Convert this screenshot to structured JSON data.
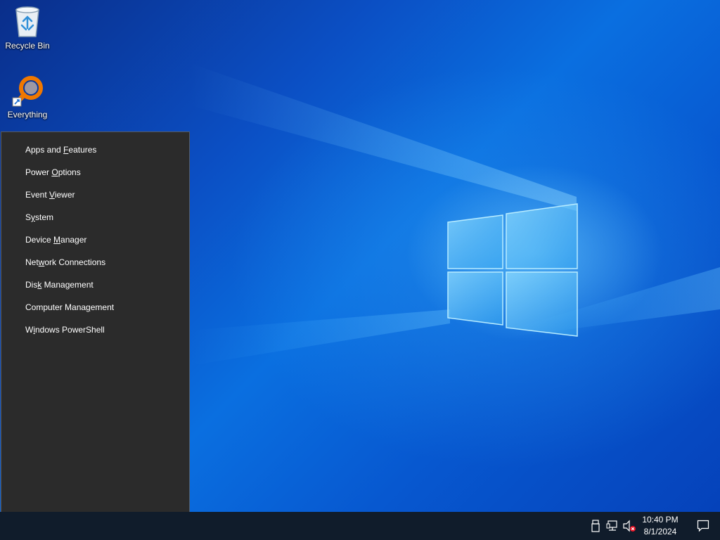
{
  "desktop": {
    "icons": [
      {
        "label": "Recycle Bin",
        "icon": "recycle-bin-icon"
      },
      {
        "label": "Everything",
        "icon": "everything-search-icon"
      }
    ]
  },
  "winx_menu": {
    "items": [
      {
        "pre": "Apps and ",
        "key": "F",
        "post": "eatures"
      },
      {
        "pre": "Power ",
        "key": "O",
        "post": "ptions"
      },
      {
        "pre": "Event ",
        "key": "V",
        "post": "iewer"
      },
      {
        "pre": "S",
        "key": "y",
        "post": "stem"
      },
      {
        "pre": "Device ",
        "key": "M",
        "post": "anager"
      },
      {
        "pre": "Net",
        "key": "w",
        "post": "ork Connections"
      },
      {
        "pre": "Dis",
        "key": "k",
        "post": " Management"
      },
      {
        "pre": "Computer Mana",
        "key": "g",
        "post": "ement"
      },
      {
        "pre": "W",
        "key": "i",
        "post": "ndows PowerShell"
      }
    ]
  },
  "taskbar": {
    "tray_icons": [
      "usb-drive-icon",
      "network-icon",
      "volume-muted-icon"
    ],
    "clock": {
      "time": "10:40 PM",
      "date": "8/1/2024"
    },
    "notification_icon": "action-center-icon",
    "colors": {
      "background": "#101c2b",
      "menu": "#2b2b2b"
    }
  }
}
